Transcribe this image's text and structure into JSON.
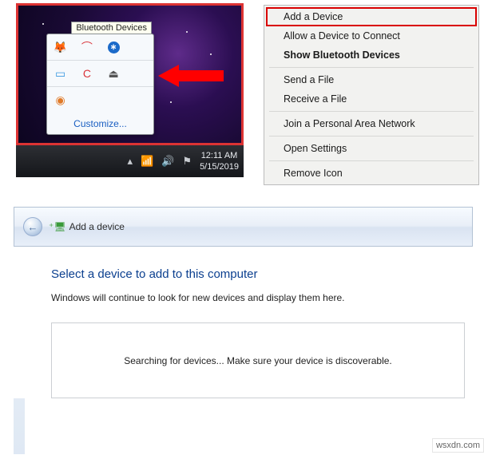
{
  "tray": {
    "tooltip": "Bluetooth Devices",
    "icons": [
      "fox-icon",
      "airtel-icon",
      "bluetooth-icon",
      "blank",
      "battery-icon",
      "ccleaner-icon",
      "eject-icon",
      "blank",
      "disc-icon",
      "blank",
      "blank",
      "blank"
    ],
    "customize": "Customize..."
  },
  "taskbar": {
    "time": "12:11 AM",
    "date": "5/15/2019"
  },
  "context_menu": [
    {
      "label": "Add a Device",
      "highlight": true,
      "bold": false
    },
    {
      "label": "Allow a Device to Connect",
      "highlight": false,
      "bold": false
    },
    {
      "label": "Show Bluetooth Devices",
      "highlight": false,
      "bold": true
    },
    {
      "sep": true
    },
    {
      "label": "Send a File",
      "highlight": false,
      "bold": false
    },
    {
      "label": "Receive a File",
      "highlight": false,
      "bold": false
    },
    {
      "sep": true
    },
    {
      "label": "Join a Personal Area Network",
      "highlight": false,
      "bold": false
    },
    {
      "sep": true
    },
    {
      "label": "Open Settings",
      "highlight": false,
      "bold": false
    },
    {
      "sep": true
    },
    {
      "label": "Remove Icon",
      "highlight": false,
      "bold": false
    }
  ],
  "wizard": {
    "title": "Add a device",
    "heading": "Select a device to add to this computer",
    "subtext": "Windows will continue to look for new devices and display them here.",
    "searching": "Searching for devices...  Make sure your device is discoverable."
  },
  "watermark": "wsxdn.com"
}
